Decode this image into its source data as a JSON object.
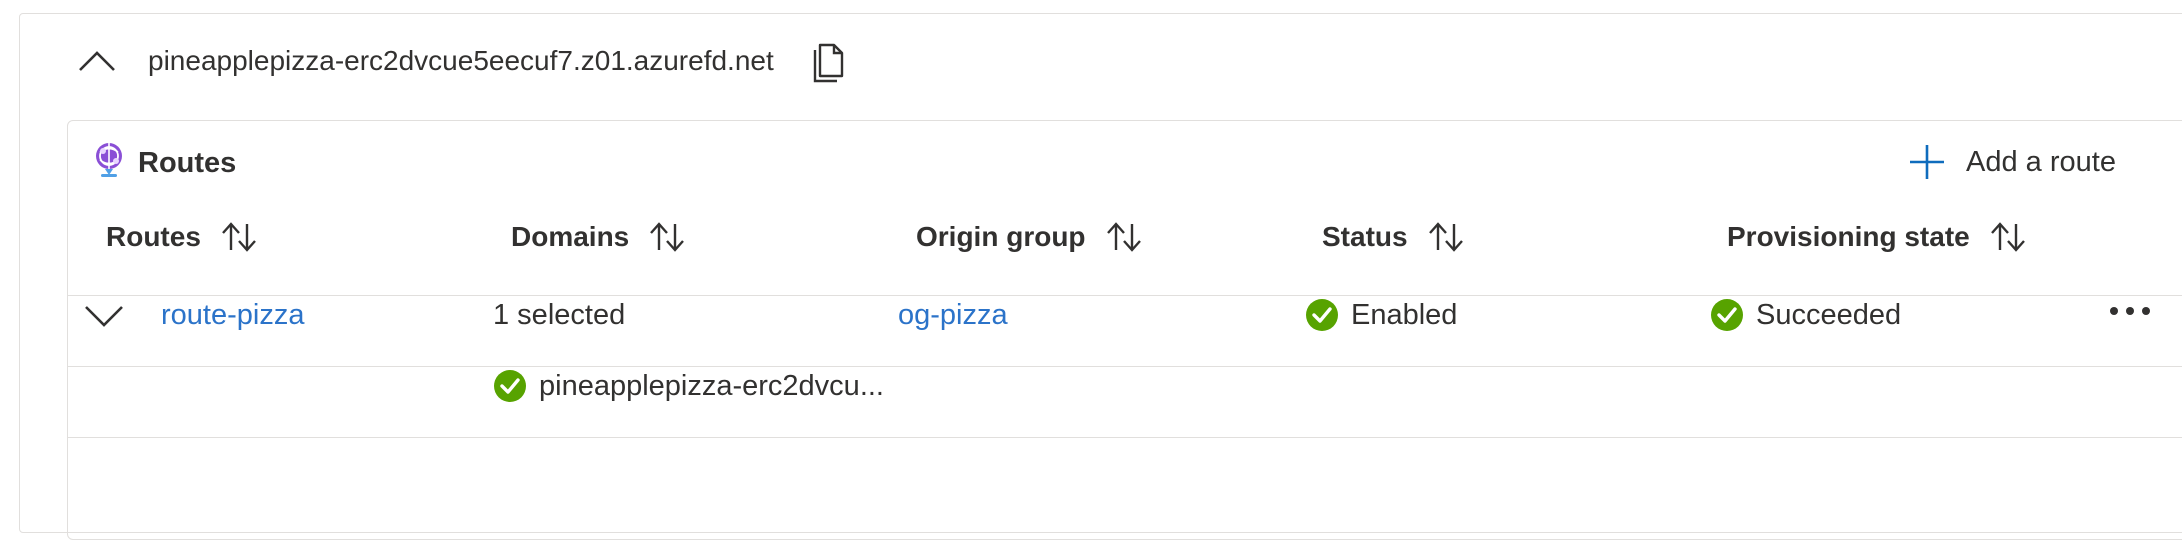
{
  "endpoint": {
    "hostname": "pineapplepizza-erc2dvcue5eecuf7.z01.azurefd.net"
  },
  "routes_card": {
    "title": "Routes",
    "add_route_label": "Add a route",
    "columns": [
      "Routes",
      "Domains",
      "Origin group",
      "Status",
      "Provisioning state"
    ],
    "rows": [
      {
        "route": "route-pizza",
        "domains": "1 selected",
        "origin_group": "og-pizza",
        "status": "Enabled",
        "provisioning_state": "Succeeded",
        "expanded": true,
        "domain_list": [
          "pineapplepizza-erc2dvcu..."
        ]
      }
    ]
  },
  "colors": {
    "link": "#2b73c9",
    "success": "#57a300",
    "accent": "#0f6cbd",
    "border": "#e1dfdd"
  },
  "icons": [
    "chevron-up-icon",
    "copy-icon",
    "routes-icon",
    "add-icon",
    "sort-icon",
    "chevron-down-icon",
    "check-circle-icon",
    "more-icon"
  ]
}
